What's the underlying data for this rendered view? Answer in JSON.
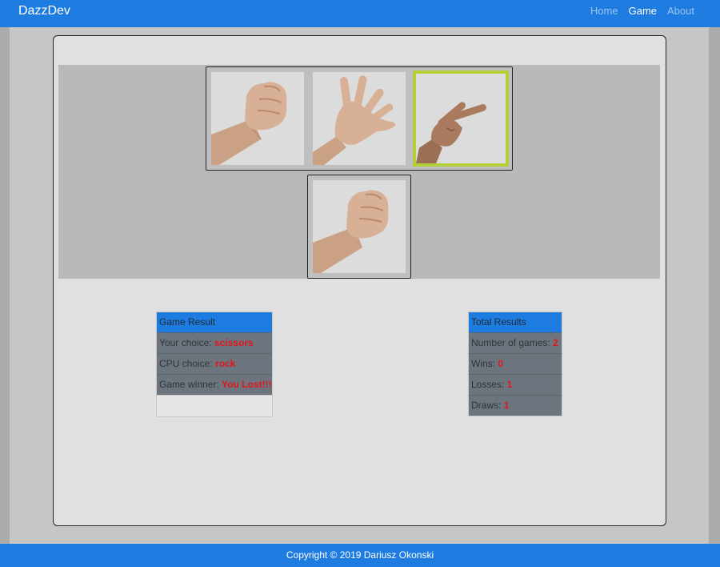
{
  "navbar": {
    "brand": "DazzDev",
    "links": [
      "Home",
      "Game",
      "About"
    ],
    "active": "Game"
  },
  "game": {
    "choices": [
      {
        "name": "rock",
        "icon": "fist-hand-icon"
      },
      {
        "name": "paper",
        "icon": "open-hand-icon"
      },
      {
        "name": "scissors",
        "icon": "victory-hand-icon",
        "selected": true
      }
    ],
    "cpu_choice_icon": "fist-hand-icon"
  },
  "game_result": {
    "title": "Game Result",
    "your_choice_label": "Your choice:",
    "your_choice_value": "scissors",
    "cpu_choice_label": "CPU choice:",
    "cpu_choice_value": "rock",
    "winner_label": "Game winner:",
    "winner_value": "You Lost!!!"
  },
  "total_results": {
    "title": "Total Results",
    "games_label": "Number of games:",
    "games_value": "2",
    "wins_label": "Wins:",
    "wins_value": "0",
    "losses_label": "Losses:",
    "losses_value": "1",
    "draws_label": "Draws:",
    "draws_value": "1"
  },
  "footer": {
    "text": "Copyright © 2019 Dariusz Okonski"
  },
  "colors": {
    "primary": "#1e7be0",
    "panel_gray": "#6c757d",
    "highlight_red": "#e0161c",
    "selected_border": "#b5cf3a"
  }
}
